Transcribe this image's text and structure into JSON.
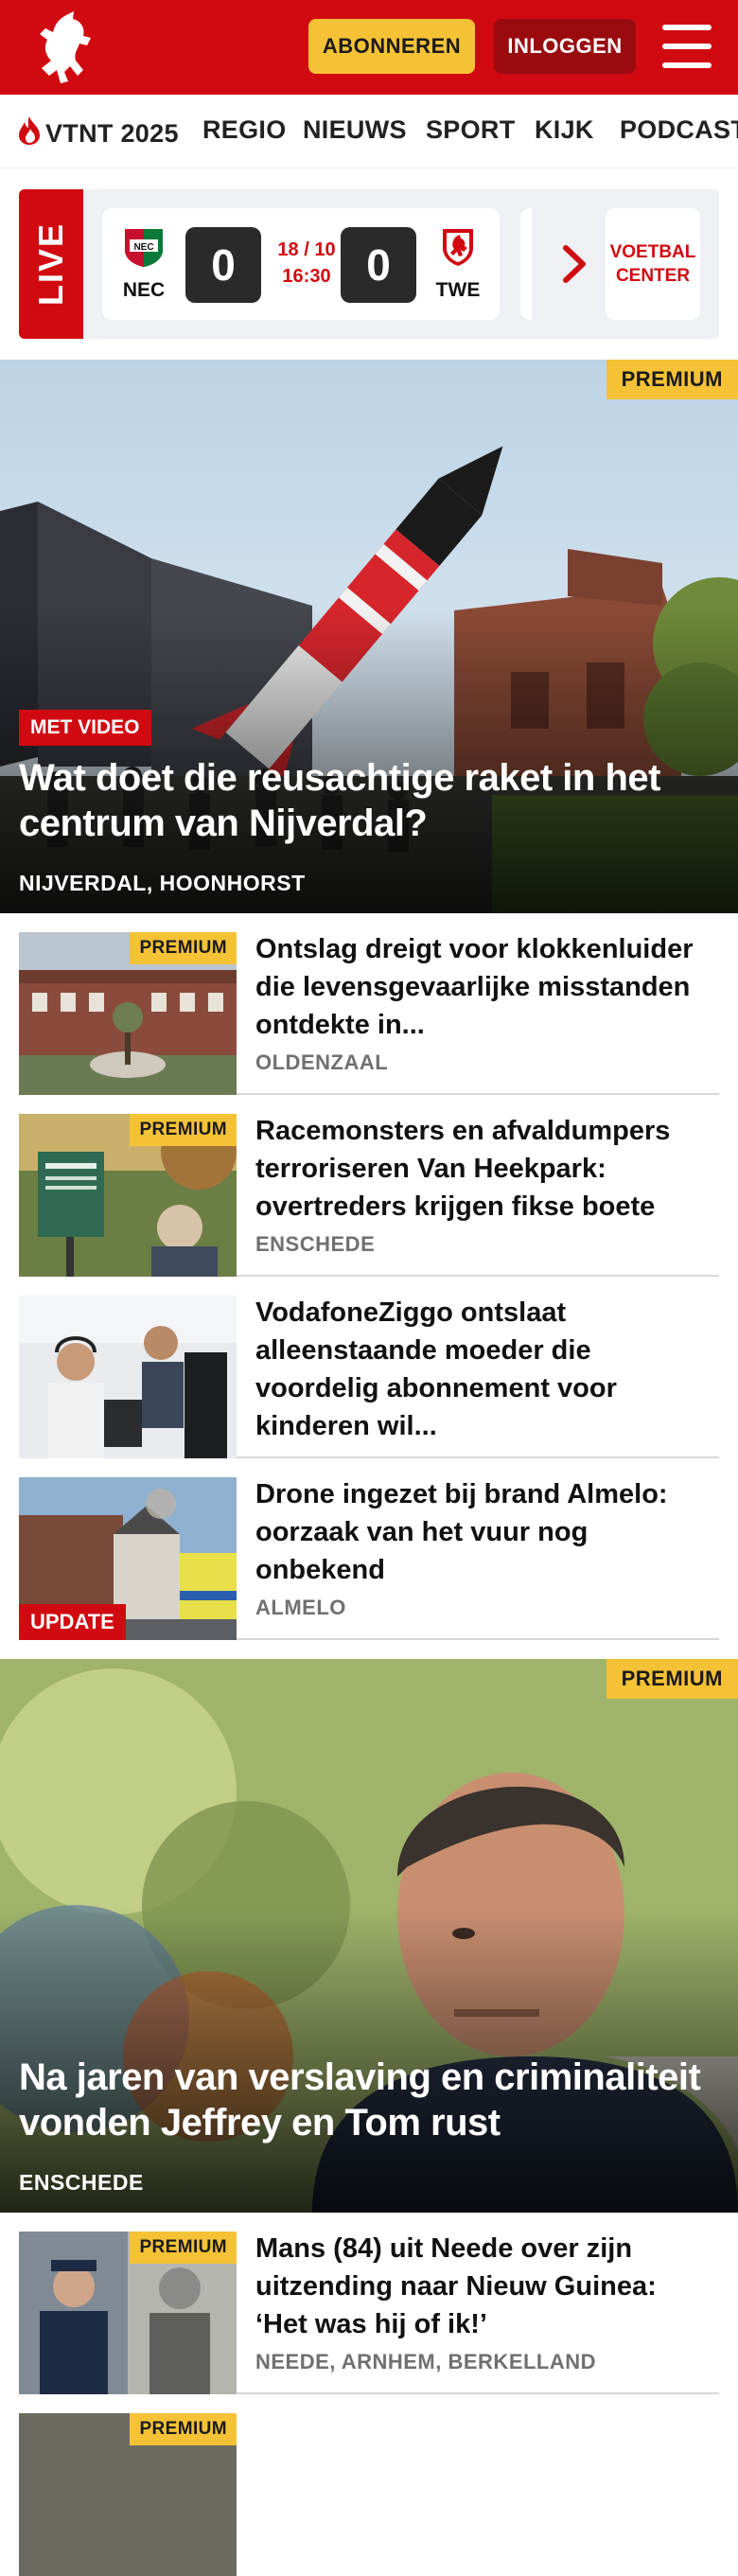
{
  "header": {
    "logo_icon": "tubantia-horse-logo",
    "subscribe_label": "ABONNEREN",
    "login_label": "INLOGGEN",
    "menu_icon": "hamburger-menu-icon",
    "brand_color": "#d10a11",
    "accent_color": "#f5c236"
  },
  "nav": {
    "items": [
      {
        "label": "VTNT 2025",
        "icon": "flame-icon"
      },
      {
        "label": "REGIO"
      },
      {
        "label": "NIEUWS"
      },
      {
        "label": "SPORT"
      },
      {
        "label": "KIJK"
      },
      {
        "label": "PODCAST"
      }
    ]
  },
  "live": {
    "label": "LIVE",
    "match": {
      "home": "NEC",
      "home_score": "0",
      "away": "TWE",
      "away_score": "0",
      "date": "18 / 10",
      "time": "16:30"
    },
    "center_label_line1": "VOETBAL",
    "center_label_line2": "CENTER"
  },
  "hero1": {
    "premium": "PREMIUM",
    "tag": "MET VIDEO",
    "title": "Wat doet die reusachtige raket in het centrum van Nijverdal?",
    "location": "NIJVERDAL, HOONHORST"
  },
  "articles": [
    {
      "premium": "PREMIUM",
      "title": "Ontslag dreigt voor klokkenluider die levensgevaarlijke misstanden ontdekte in...",
      "location": "OLDENZAAL"
    },
    {
      "premium": "PREMIUM",
      "title": "Racemonsters en afvaldumpers terroriseren Van Heekpark: overtreders krijgen fikse boete",
      "location": "ENSCHEDE"
    },
    {
      "title": "VodafoneZiggo ontslaat alleenstaande moeder die voordelig abonnement voor kinderen wil...",
      "location": ""
    },
    {
      "tag": "UPDATE",
      "title": "Drone ingezet bij brand Almelo: oorzaak van het vuur nog onbekend",
      "location": "ALMELO"
    }
  ],
  "hero2": {
    "premium": "PREMIUM",
    "title": "Na jaren van verslaving en criminaliteit vonden Jeffrey en Tom rust",
    "location": "ENSCHEDE"
  },
  "articles2": [
    {
      "premium": "PREMIUM",
      "title": "Mans (84) uit Neede over zijn uitzending naar Nieuw Guinea: ‘Het was hij of ik!’",
      "location": "NEEDE, ARNHEM, BERKELLAND"
    },
    {
      "premium": "PREMIUM"
    }
  ]
}
